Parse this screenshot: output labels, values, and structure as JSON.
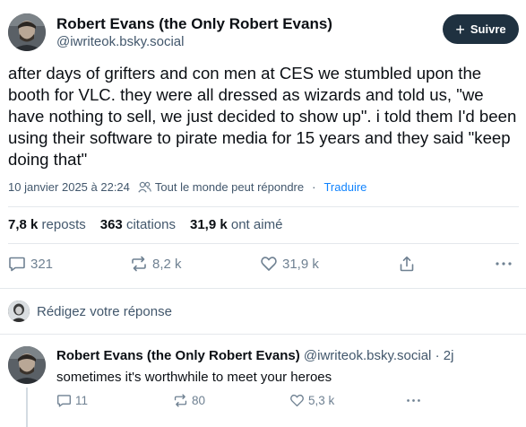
{
  "post": {
    "author_name": "Robert Evans (the Only Robert Evans)",
    "author_handle": "@iwriteok.bsky.social",
    "follow_label": "Suivre",
    "text": "after days of grifters and con men at CES we stumbled upon the booth for VLC. they were all dressed as wizards and told us, \"we have nothing to sell, we just decided to show up\". i told them I'd been using their software to pirate media for 15 years and they said \"keep doing that\"",
    "timestamp": "10 janvier 2025 à 22:24",
    "reply_permission": "Tout le monde peut répondre",
    "separator": "·",
    "translate_label": "Traduire"
  },
  "stats": {
    "reposts_count": "7,8 k",
    "reposts_label": "reposts",
    "quotes_count": "363",
    "quotes_label": "citations",
    "likes_count": "31,9 k",
    "likes_label": "ont aimé"
  },
  "actions": {
    "replies": "321",
    "reposts": "8,2 k",
    "likes": "31,9 k"
  },
  "compose": {
    "placeholder": "Rédigez votre réponse"
  },
  "reply": {
    "author_name": "Robert Evans (the Only Robert Evans)",
    "author_handle": "@iwriteok.bsky.social",
    "separator": "·",
    "time": "2j",
    "text": "sometimes it's worthwhile to meet your heroes",
    "replies": "11",
    "reposts": "80",
    "likes": "5,3 k"
  },
  "colors": {
    "accent": "#1083fe",
    "follow_button": "#1f3140",
    "muted_text": "#42576c",
    "icon": "#6f8192"
  },
  "icons": [
    "plus-icon",
    "people-icon",
    "reply-icon",
    "repost-icon",
    "heart-icon",
    "share-icon",
    "more-icon"
  ]
}
